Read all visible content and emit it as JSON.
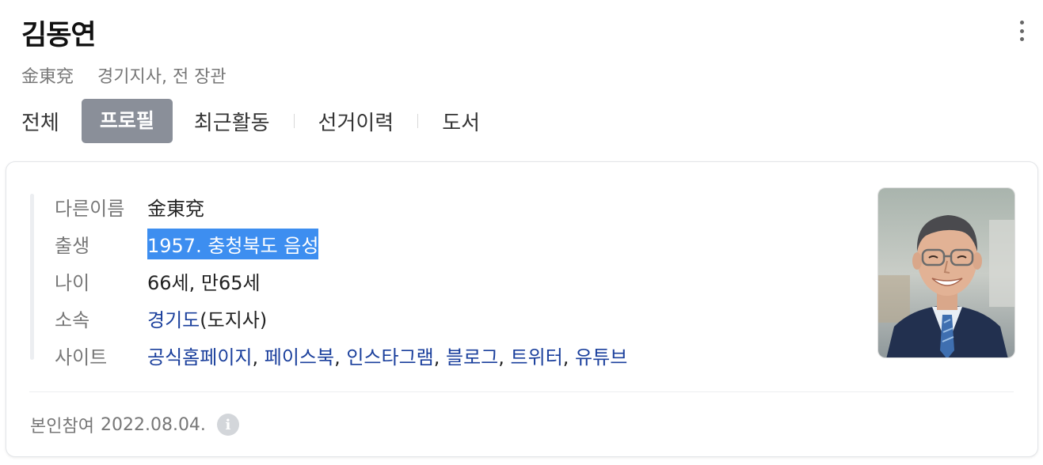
{
  "profile": {
    "name": "김동연",
    "hanja": "金東兗",
    "description": "경기지사, 전 장관"
  },
  "tabs": [
    {
      "label": "전체",
      "active": false
    },
    {
      "label": "프로필",
      "active": true
    },
    {
      "label": "최근활동",
      "active": false
    },
    {
      "label": "선거이력",
      "active": false
    },
    {
      "label": "도서",
      "active": false
    }
  ],
  "info": {
    "other_name": {
      "label": "다른이름",
      "value": "金東兗"
    },
    "birth": {
      "label": "출생",
      "value": "1957. 충청북도 음성"
    },
    "age": {
      "label": "나이",
      "value": "66세, 만65세"
    },
    "affiliation": {
      "label": "소속",
      "link": "경기도",
      "suffix": "(도지사)"
    },
    "sites": {
      "label": "사이트",
      "links": [
        "공식홈페이지",
        "페이스북",
        "인스타그램",
        "블로그",
        "트위터",
        "유튜브"
      ],
      "separator": ", "
    }
  },
  "footer": {
    "label": "본인참여",
    "date": "2022.08.04."
  },
  "icons": {
    "more": "more-vertical-icon",
    "info": "info-icon",
    "info_glyph": "i"
  },
  "colors": {
    "link": "#1a3f9c",
    "active_tab_bg": "#8a8f99",
    "selection": "#3d8ef0"
  }
}
